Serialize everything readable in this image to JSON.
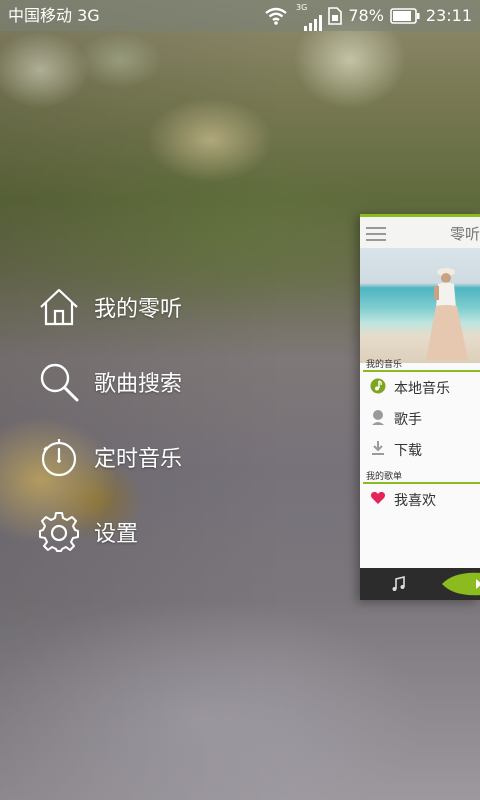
{
  "status_bar": {
    "carrier": "中国移动 3G",
    "network_type": "3G",
    "battery": "78%",
    "time": "23:11"
  },
  "drawer_menu": {
    "items": [
      {
        "label": "我的零听",
        "icon": "home-icon"
      },
      {
        "label": "歌曲搜索",
        "icon": "search-icon"
      },
      {
        "label": "定时音乐",
        "icon": "timer-icon"
      },
      {
        "label": "设置",
        "icon": "gear-icon"
      }
    ]
  },
  "preview": {
    "title": "零听",
    "section_my_music": "我的音乐",
    "items": [
      {
        "label": "本地音乐",
        "icon": "music-note-icon"
      },
      {
        "label": "歌手",
        "icon": "singer-icon"
      },
      {
        "label": "下载",
        "icon": "download-icon"
      }
    ],
    "section_my_playlists": "我的歌单",
    "favorites": {
      "label": "我喜欢",
      "icon": "heart-icon"
    }
  },
  "colors": {
    "accent_green": "#8bbb1f",
    "heart_pink": "#e5245a",
    "footer_dark": "#2c2c2c"
  }
}
